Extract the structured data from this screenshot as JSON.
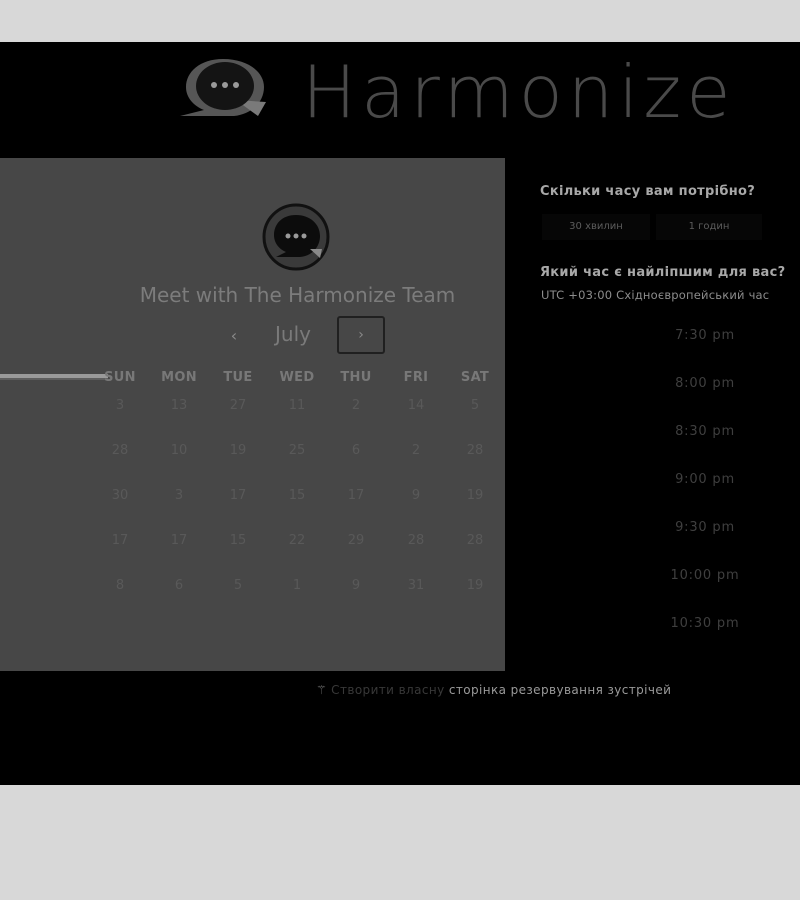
{
  "header": {
    "brand_name": "Harmonize"
  },
  "calendar": {
    "title": "Meet with The Harmonize Team",
    "month": "July",
    "prev_label": "‹",
    "next_label": "›",
    "weekdays": [
      "SUN",
      "MON",
      "TUE",
      "WED",
      "THU",
      "FRI",
      "SAT"
    ],
    "weeks": [
      [
        "3",
        "13",
        "27",
        "11",
        "2",
        "14",
        "5"
      ],
      [
        "28",
        "10",
        "19",
        "25",
        "6",
        "2",
        "28"
      ],
      [
        "30",
        "3",
        "17",
        "15",
        "17",
        "9",
        "19"
      ],
      [
        "17",
        "17",
        "15",
        "22",
        "29",
        "28",
        "28"
      ],
      [
        "8",
        "6",
        "5",
        "1",
        "9",
        "31",
        "19"
      ]
    ]
  },
  "duration": {
    "question": "Скільки часу вам потрібно?",
    "options": [
      "30 хвилин",
      "1 годин"
    ]
  },
  "times": {
    "question": "Який час є найліпшим для вас?",
    "timezone": "UTC +03:00 Східноєвропейський час",
    "slots": [
      "7:30 pm",
      "8:00 pm",
      "8:30 pm",
      "9:00 pm",
      "9:30 pm",
      "10:00 pm",
      "10:30 pm"
    ]
  },
  "footer": {
    "icon": "magic-wand-icon",
    "prefix": "Створити власну",
    "link": "сторінка резервування зустрічей"
  }
}
